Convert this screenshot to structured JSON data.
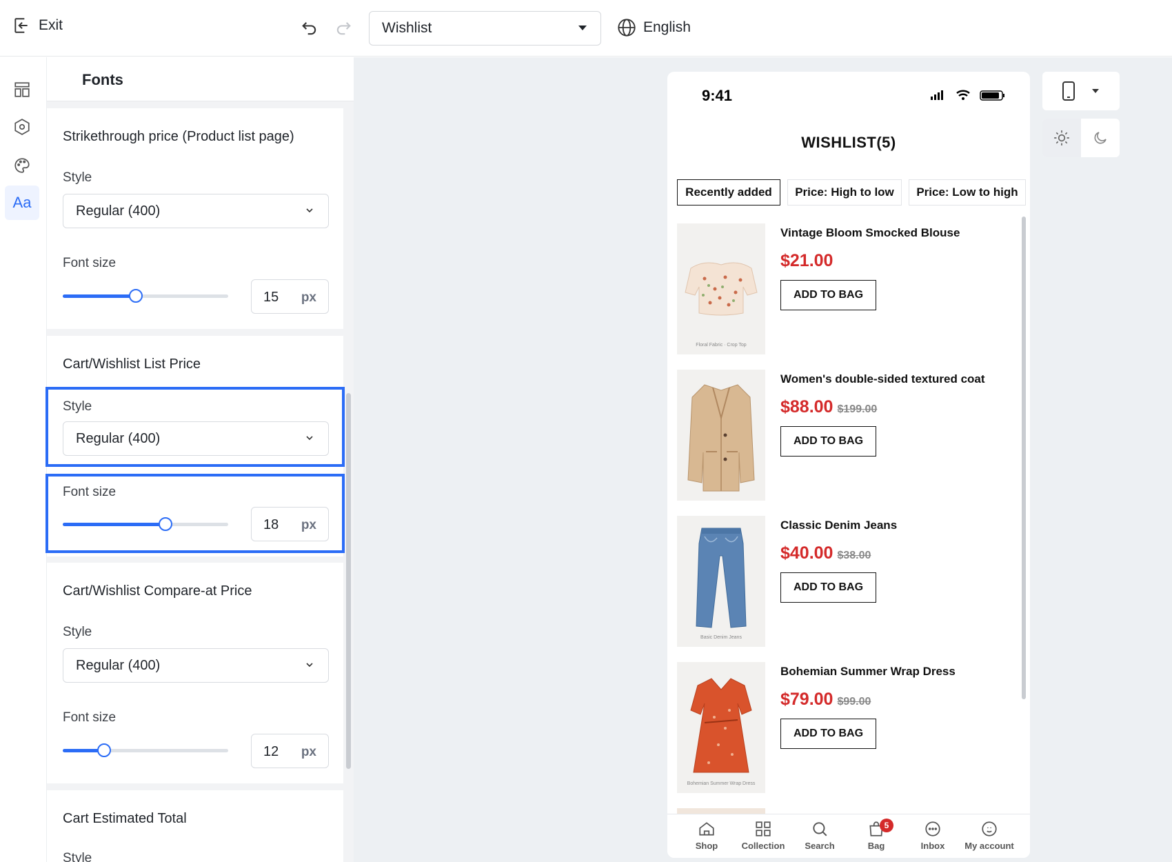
{
  "topbar": {
    "exit_label": "Exit",
    "page_select_value": "Wishlist",
    "language": "English"
  },
  "panel": {
    "title": "Fonts",
    "sections": [
      {
        "title": "Strikethrough price (Product list page)",
        "style_label": "Style",
        "style_value": "Regular (400)",
        "size_label": "Font size",
        "size_value": "15",
        "unit": "px",
        "slider_fraction": 0.44
      },
      {
        "title": "Cart/Wishlist List Price",
        "style_label": "Style",
        "style_value": "Regular (400)",
        "size_label": "Font size",
        "size_value": "18",
        "unit": "px",
        "slider_fraction": 0.62
      },
      {
        "title": "Cart/Wishlist Compare-at Price",
        "style_label": "Style",
        "style_value": "Regular (400)",
        "size_label": "Font size",
        "size_value": "12",
        "unit": "px",
        "slider_fraction": 0.25
      },
      {
        "title": "Cart Estimated Total",
        "style_label": "Style"
      }
    ]
  },
  "preview": {
    "time": "9:41",
    "title": "WISHLIST(5)",
    "sort_options": [
      "Recently added",
      "Price: High to low",
      "Price: Low to high"
    ],
    "add_label": "ADD TO BAG",
    "products": [
      {
        "name": "Vintage Bloom Smocked Blouse",
        "price": "$21.00",
        "compare": "",
        "caption": "Floral Fabric · Crop Top"
      },
      {
        "name": "Women's double-sided textured coat",
        "price": "$88.00",
        "compare": "$199.00",
        "caption": ""
      },
      {
        "name": "Classic Denim Jeans",
        "price": "$40.00",
        "compare": "$38.00",
        "caption": "Basic Denim Jeans"
      },
      {
        "name": "Bohemian Summer Wrap Dress",
        "price": "$79.00",
        "compare": "$99.00",
        "caption": "Bohemian Summer Wrap Dress"
      }
    ],
    "tabs": [
      "Shop",
      "Collection",
      "Search",
      "Bag",
      "Inbox",
      "My account"
    ],
    "bag_count": "5"
  },
  "colors": {
    "accent": "#2b6cf6",
    "price_red": "#d42a2a"
  }
}
